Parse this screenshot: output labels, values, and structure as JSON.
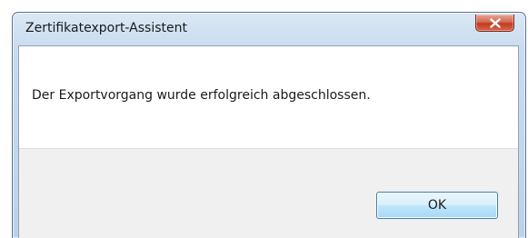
{
  "window": {
    "title": "Zertifikatexport-Assistent"
  },
  "dialog": {
    "message": "Der Exportvorgang wurde erfolgreich abgeschlossen.",
    "ok_label": "OK"
  },
  "icons": {
    "close": "close-icon"
  },
  "colors": {
    "close_button": "#c23b1f",
    "ok_button_border": "#3c7fb1",
    "footer_background": "#f0f0f0"
  }
}
